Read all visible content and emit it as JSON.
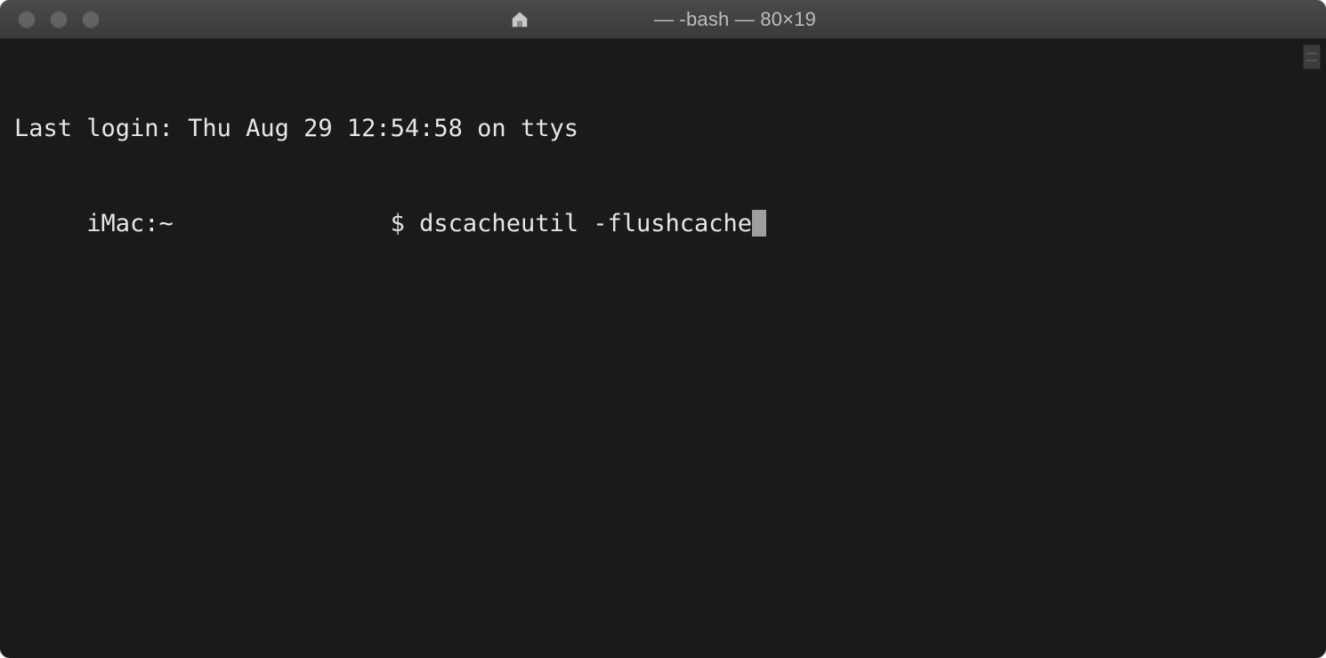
{
  "window": {
    "title": "— -bash — 80×19",
    "traffic_lights": {
      "close": "close",
      "minimize": "minimize",
      "zoom": "zoom"
    },
    "icon": "home-icon"
  },
  "terminal": {
    "last_login_line": "Last login: Thu Aug 29 12:54:58 on ttys",
    "prompt_host": "     iMac:~               ",
    "prompt_symbol": "$ ",
    "command": "dscacheutil -flushcache"
  },
  "colors": {
    "bg": "#1a1a1a",
    "text": "#e6e6e6",
    "titlebar_text": "#bdbdbd",
    "cursor": "#9e9e9e"
  }
}
